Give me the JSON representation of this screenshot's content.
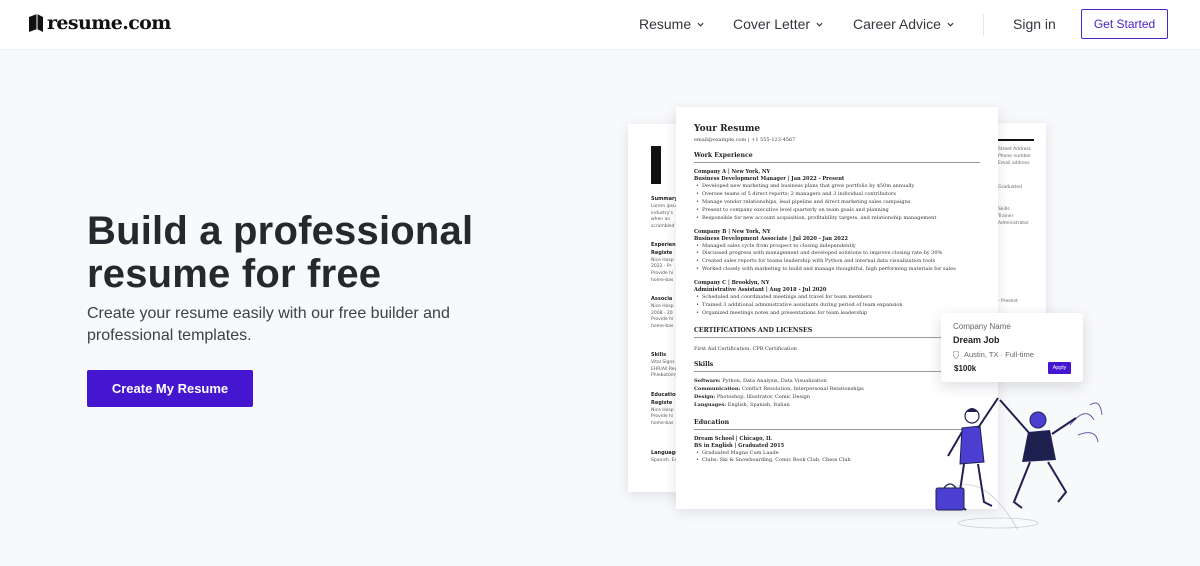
{
  "header": {
    "brand": "resume.com",
    "nav": [
      {
        "label": "Resume"
      },
      {
        "label": "Cover Letter"
      },
      {
        "label": "Career Advice"
      }
    ],
    "sign_in": "Sign in",
    "get_started": "Get Started"
  },
  "hero": {
    "title": "Build a professional resume for free",
    "subtitle": "Create your resume easily with our free builder and professional templates.",
    "cta": "Create My Resume"
  },
  "resume_preview": {
    "name": "Your Resume",
    "contact": "email@example.com  |  +1 555-123-4567",
    "work_heading": "Work Experience",
    "jobs": [
      {
        "company": "Company A  |  New York, NY",
        "role": "Business Development Manager  |  Jan 2022 - Present",
        "bullets": [
          "Developed new marketing and business plans that grew portfolio by $50m annually",
          "Oversee teams of 5 direct reports; 2 managers and 3 individual contributors",
          "Manage vendor relationships, lead pipeline and direct marketing sales campaigns",
          "Present to company executive level quarterly on team goals and planning",
          "Responsible for new account acquisition, profitability targets, and relationship management"
        ]
      },
      {
        "company": "Company B  |  New York, NY",
        "role": "Business Development Associate  |  Jul 2020 - Jan 2022",
        "bullets": [
          "Managed sales cycle from prospect to closing independently",
          "Discussed progress with management and developed solutions to improve closing rate by 30%",
          "Created sales reports for teams leadership with Python and internal data visualization tools",
          "Worked closely with marketing to build and manage thoughtful, high performing materials for sales"
        ]
      },
      {
        "company": "Company C  |  Brooklyn, NY",
        "role": "Administrative Assistant  |  Aug 2018 - Jul 2020",
        "bullets": [
          "Scheduled and coordinated meetings and travel for team members",
          "Trained 3 additional administrative assistants during period of team expansion",
          "Organized meetings notes and presentations for team leadership"
        ]
      }
    ],
    "certs_heading": "CERTIFICATIONS AND LICENSES",
    "certs": "First Aid Certification, CPR Certification",
    "skills_heading": "Skills",
    "skills": [
      {
        "label": "Software:",
        "value": "Python, Data Analysis, Data Visualization"
      },
      {
        "label": "Communication:",
        "value": "Conflict Resolution, Interpersonal Relationships"
      },
      {
        "label": "Design:",
        "value": "Photoshop, Illustrator, Comic Design"
      },
      {
        "label": "Languages:",
        "value": "English, Spanish, Italian"
      }
    ],
    "education_heading": "Education",
    "education": {
      "school": "Dream School  |  Chicago, IL",
      "degree": "BS in English  |  Graduated 2015",
      "bullets": [
        "Graduated Magna Cum Laude",
        "Clubs: Ski & Snowboarding, Comic Book Club, Chess Club"
      ]
    }
  },
  "job_card": {
    "company": "Company Name",
    "title": "Dream Job",
    "location": "Austin, TX · Full-time",
    "salary": "$100k",
    "apply": "Apply"
  },
  "colors": {
    "brand_purple": "#4516d0",
    "background": "#f8f9fb"
  }
}
